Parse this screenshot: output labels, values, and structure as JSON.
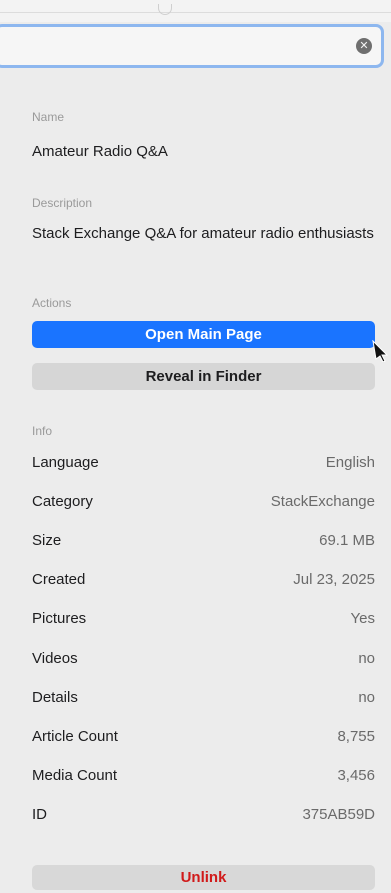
{
  "search": {
    "value": "",
    "clear_icon": "clear-circle-x-icon"
  },
  "name": {
    "label": "Name",
    "value": "Amateur Radio Q&A"
  },
  "description": {
    "label": "Description",
    "value": "Stack Exchange Q&A for amateur radio enthusiasts"
  },
  "actions": {
    "label": "Actions",
    "open_main_page": "Open Main Page",
    "reveal_in_finder": "Reveal in Finder"
  },
  "info": {
    "label": "Info",
    "rows": [
      {
        "key": "Language",
        "value": "English"
      },
      {
        "key": "Category",
        "value": "StackExchange"
      },
      {
        "key": "Size",
        "value": "69.1 MB"
      },
      {
        "key": "Created",
        "value": "Jul 23, 2025"
      },
      {
        "key": "Pictures",
        "value": "Yes"
      },
      {
        "key": "Videos",
        "value": "no"
      },
      {
        "key": "Details",
        "value": "no"
      },
      {
        "key": "Article Count",
        "value": "8,755"
      },
      {
        "key": "Media Count",
        "value": "3,456"
      },
      {
        "key": "ID",
        "value": "375AB59D"
      }
    ]
  },
  "unlink": {
    "label": "Unlink"
  },
  "colors": {
    "accent": "#1a74ff",
    "destructive": "#d11a1a",
    "focus_ring": "#8db7ef"
  }
}
